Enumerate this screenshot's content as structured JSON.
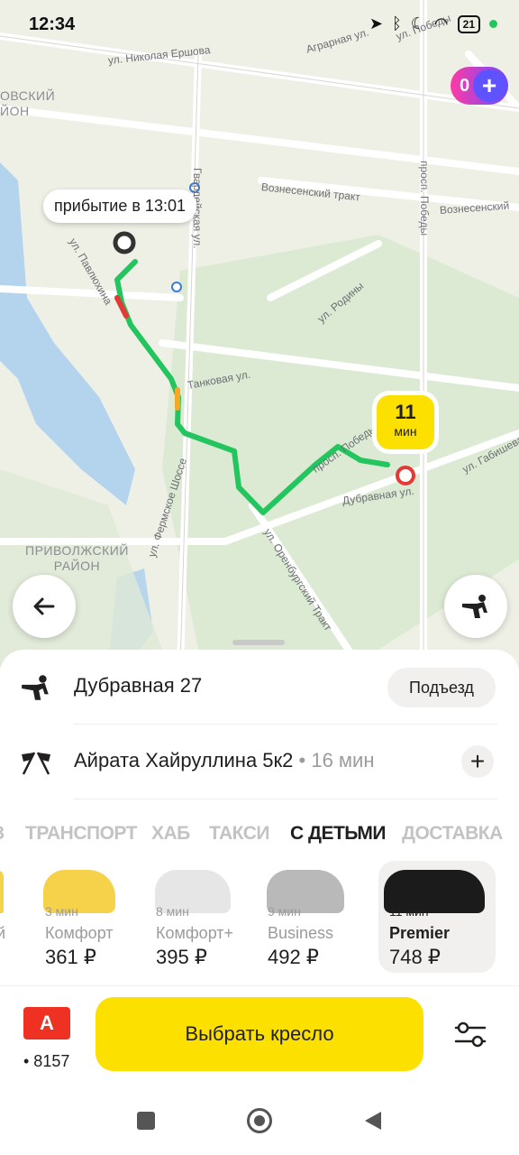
{
  "status_bar": {
    "time": "12:34",
    "battery": "21",
    "icons": [
      "location-arrow-icon",
      "bluetooth-icon",
      "moon-icon",
      "wifi-icon"
    ]
  },
  "map": {
    "streets": [
      "ул. Николая Ершова",
      "Гвардейская ул.",
      "Вознесенский тракт",
      "просп. Победы",
      "Вознесенский",
      "ул. Павлюхина",
      "ул. Родины",
      "Танковая ул.",
      "просп. Победы",
      "ул. Габишева",
      "Дубравная ул.",
      "ул. Фермское Шоссе",
      "ул. Оренбургский Тракт",
      "Аграрная ул.",
      "ул. Победы"
    ],
    "districts": [
      "ОВСКИЙ\nЙОН",
      "ПРИВОЛЖСКИЙ\nРАЙОН"
    ],
    "arrival_label": "прибытие в 13:01",
    "eta_value": "11",
    "eta_unit": "мин",
    "plus_points": "0"
  },
  "route": {
    "from": "Дубравная 27",
    "entrance_button": "Подъезд",
    "to": "Айрата Хайруллина 5к2",
    "to_eta": "• 16 мин"
  },
  "tabs": {
    "items": [
      "З",
      "ТРАНСПОРТ",
      "ХАБ",
      "ТАКСИ",
      "С ДЕТЬМИ",
      "ДОСТАВКА"
    ],
    "active": "С ДЕТЬМИ"
  },
  "tariffs": [
    {
      "time": "",
      "name": "й",
      "price": "",
      "color": "#f3d34a"
    },
    {
      "time": "3 мин",
      "name": "Комфорт",
      "price": "361 ₽",
      "color": "#f5d24a"
    },
    {
      "time": "8 мин",
      "name": "Комфорт+",
      "price": "395 ₽",
      "color": "#e6e6e6"
    },
    {
      "time": "9 мин",
      "name": "Business",
      "price": "492 ₽",
      "color": "#b9b9b9"
    },
    {
      "time": "11 мин",
      "name": "Premier",
      "price": "748 ₽",
      "color": "#1b1b1b",
      "selected": true
    }
  ],
  "payment": {
    "card_logo": "А",
    "card_number": "• 8157"
  },
  "main_button": "Выбрать кресло",
  "colors": {
    "accent_yellow": "#fce000",
    "route_green": "#22c55e",
    "route_red": "#e53935",
    "route_orange": "#f5a623"
  }
}
